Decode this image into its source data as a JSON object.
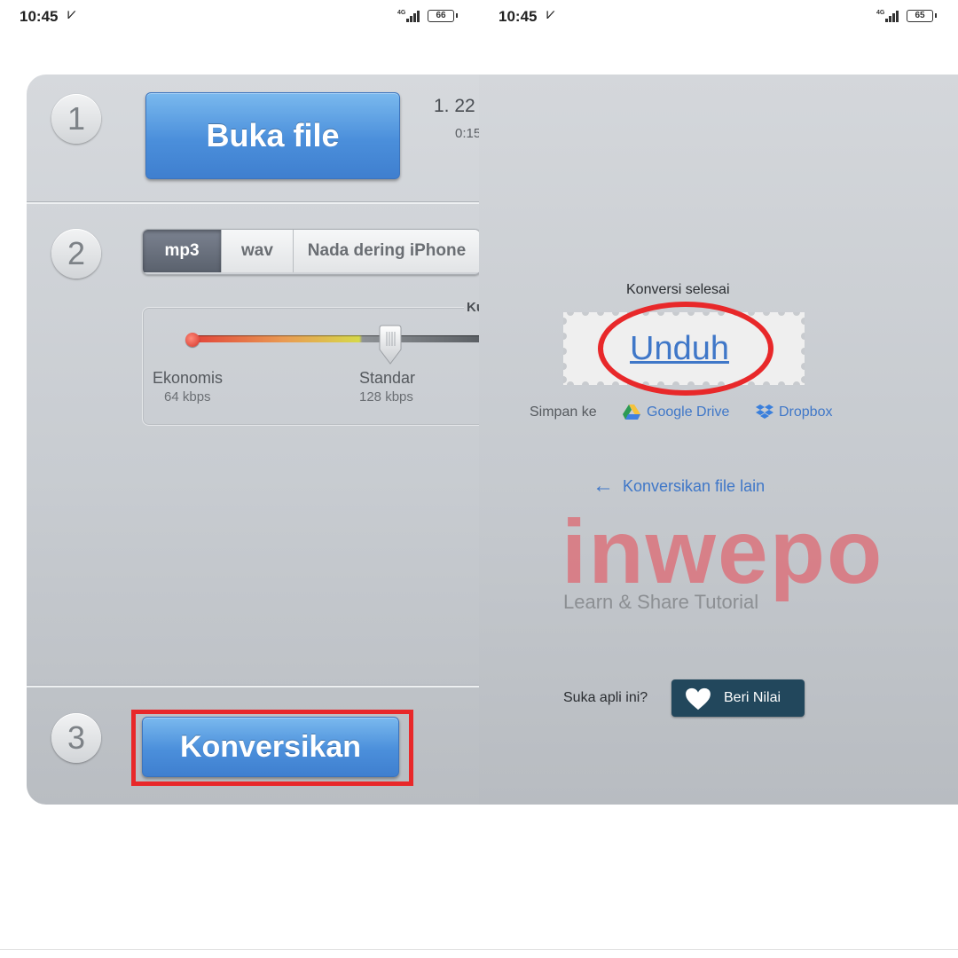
{
  "status_left": {
    "time": "10:45",
    "network": "4G",
    "battery": "66"
  },
  "status_right": {
    "time": "10:45",
    "network": "4G",
    "battery": "65"
  },
  "left": {
    "step1": {
      "number": "1",
      "open_button": "Buka file",
      "file_name": "1. 22",
      "file_duration": "0:15"
    },
    "step2": {
      "number": "2",
      "formats": [
        "mp3",
        "wav",
        "Nada dering iPhone"
      ],
      "active_format": "mp3",
      "quality_corner": "Ku",
      "quality_level": 0.64,
      "quality_labels": [
        {
          "name": "Ekonomis",
          "rate": "64 kbps"
        },
        {
          "name": "Standar",
          "rate": "128 kbps"
        }
      ]
    },
    "step3": {
      "number": "3",
      "convert_button": "Konversikan"
    }
  },
  "right": {
    "done_label": "Konversi selesai",
    "download_link": "Unduh",
    "save_label": "Simpan ke",
    "save_google": "Google Drive",
    "save_dropbox": "Dropbox",
    "back_link": "Konversikan file lain",
    "watermark": "inwepo",
    "watermark_sub": "Learn & Share Tutorial",
    "like_label": "Suka apli ini?",
    "rate_button": "Beri Nilai"
  },
  "colors": {
    "link": "#3f77c8",
    "highlight": "#e8282a",
    "rate_button": "#22475c",
    "watermark": "#d97a83"
  }
}
